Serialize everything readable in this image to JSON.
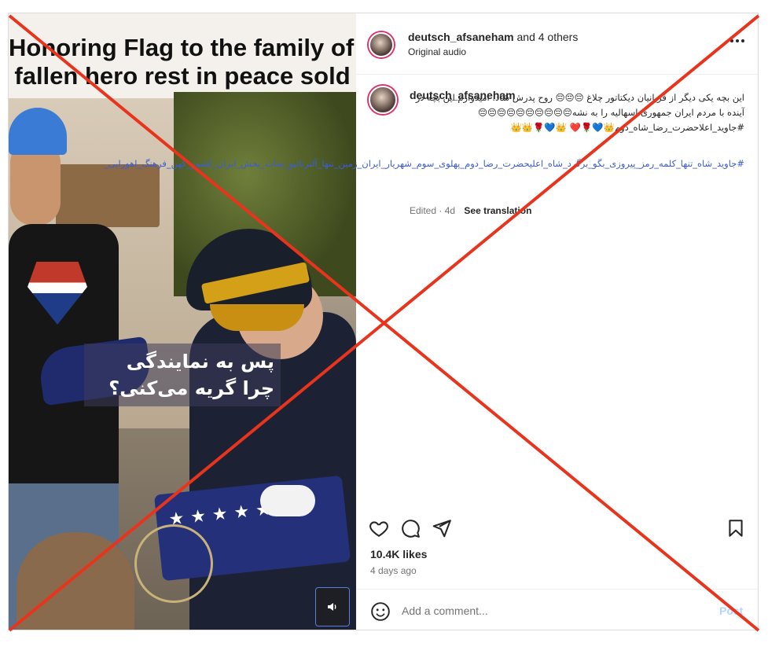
{
  "video": {
    "title_line1": "Honoring Flag to the family of t",
    "title_line2": "fallen hero rest in peace sold",
    "overlay_line1": "پس به نمایندگی",
    "overlay_line2": "چرا گریه می‌کنی؟",
    "mute_icon": "speaker-icon"
  },
  "header": {
    "username": "deutsch_afsaneham",
    "others": "and 4 others",
    "audio": "Original audio",
    "more_icon": "more-horizontal-icon"
  },
  "caption": {
    "username": "deutsch_afsaneham",
    "text": "این بچه یکی دیگر از قربانیان دیکتاتور چلاغ 😔😔😔 روح پدرش شاد. امیدوارم این بچه در آینده با مردم ایران جمهوری اسهالیه را به نشه😔😔😔😔😔😔😔😔😔😔#جاوید_اعلاحضرت_رضا_شاه_دوم👑💙🌹❤️ 👑💙🌹👑👑",
    "hashtags": "#جاوید_شاه_تنها_کلمه_رمز_پیروزی_بگو_برگرد_شاه_اعلیحضرت_رضا_دوم_پهلوی_سوم_شهریار_ایران_زمین_تنها_آلترناتیو_نجات_بخش_ایران_کشور_کهن_فرهنگ_اهورایی_",
    "edited": "Edited · 4d",
    "see_translation": "See translation"
  },
  "actions": {
    "like_icon": "heart-icon",
    "comment_icon": "comment-icon",
    "share_icon": "paper-plane-icon",
    "save_icon": "bookmark-icon"
  },
  "likes": "10.4K likes",
  "age": "4 days ago",
  "comment": {
    "placeholder": "Add a comment...",
    "post_label": "Post",
    "emoji_icon": "smiley-icon"
  },
  "colors": {
    "cross": "#e8341c",
    "link": "#3c5ed1",
    "post_disabled": "#b3d4fc",
    "muted": "#737373"
  }
}
